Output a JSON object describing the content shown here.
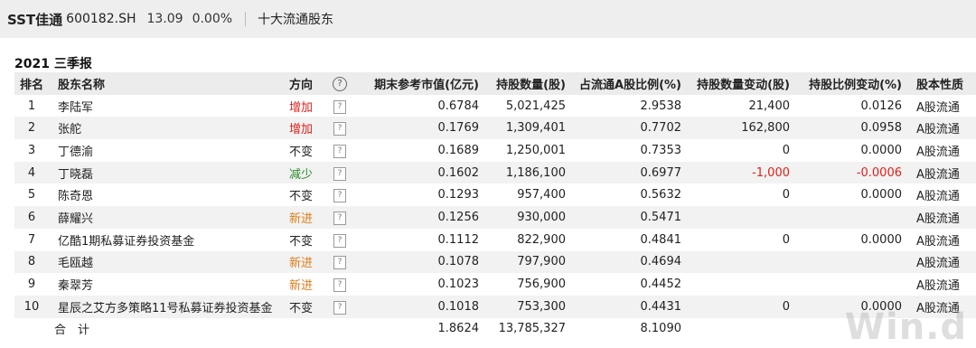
{
  "header": {
    "stock_name": "SST佳通",
    "stock_code": "600182.SH",
    "price": "13.09",
    "change_pct": "0.00%",
    "page_title": "十大流通股东"
  },
  "period": "2021 三季报",
  "columns": {
    "rank": "排名",
    "holder": "股东名称",
    "direction": "方向",
    "help": "?",
    "market_value": "期末参考市值(亿元)",
    "shares": "持股数量(股)",
    "ratio": "占流通A股比例(%)",
    "shares_change": "持股数量变动(股)",
    "ratio_change": "持股比例变动(%)",
    "share_type": "股本性质"
  },
  "rows": [
    {
      "rank": "1",
      "holder": "李陆军",
      "direction": "增加",
      "market_value": "0.6784",
      "shares": "5,021,425",
      "ratio": "2.9538",
      "shares_change": "21,400",
      "ratio_change": "0.0126",
      "share_type": "A股流通"
    },
    {
      "rank": "2",
      "holder": "张舵",
      "direction": "增加",
      "market_value": "0.1769",
      "shares": "1,309,401",
      "ratio": "0.7702",
      "shares_change": "162,800",
      "ratio_change": "0.0958",
      "share_type": "A股流通"
    },
    {
      "rank": "3",
      "holder": "丁德渝",
      "direction": "不变",
      "market_value": "0.1689",
      "shares": "1,250,001",
      "ratio": "0.7353",
      "shares_change": "0",
      "ratio_change": "0.0000",
      "share_type": "A股流通"
    },
    {
      "rank": "4",
      "holder": "丁晓磊",
      "direction": "减少",
      "market_value": "0.1602",
      "shares": "1,186,100",
      "ratio": "0.6977",
      "shares_change": "-1,000",
      "ratio_change": "-0.0006",
      "share_type": "A股流通"
    },
    {
      "rank": "5",
      "holder": "陈奇恩",
      "direction": "不变",
      "market_value": "0.1293",
      "shares": "957,400",
      "ratio": "0.5632",
      "shares_change": "0",
      "ratio_change": "0.0000",
      "share_type": "A股流通"
    },
    {
      "rank": "6",
      "holder": "薛耀兴",
      "direction": "新进",
      "market_value": "0.1256",
      "shares": "930,000",
      "ratio": "0.5471",
      "shares_change": "",
      "ratio_change": "",
      "share_type": "A股流通"
    },
    {
      "rank": "7",
      "holder": "亿酷1期私募证券投资基金",
      "direction": "不变",
      "market_value": "0.1112",
      "shares": "822,900",
      "ratio": "0.4841",
      "shares_change": "0",
      "ratio_change": "0.0000",
      "share_type": "A股流通"
    },
    {
      "rank": "8",
      "holder": "毛瓯越",
      "direction": "新进",
      "market_value": "0.1078",
      "shares": "797,900",
      "ratio": "0.4694",
      "shares_change": "",
      "ratio_change": "",
      "share_type": "A股流通"
    },
    {
      "rank": "9",
      "holder": "秦翠芳",
      "direction": "新进",
      "market_value": "0.1023",
      "shares": "756,900",
      "ratio": "0.4452",
      "shares_change": "",
      "ratio_change": "",
      "share_type": "A股流通"
    },
    {
      "rank": "10",
      "holder": "星辰之艾方多策略11号私募证券投资基金",
      "direction": "不变",
      "market_value": "0.1018",
      "shares": "753,300",
      "ratio": "0.4431",
      "shares_change": "0",
      "ratio_change": "0.0000",
      "share_type": "A股流通"
    }
  ],
  "total": {
    "label": "合　计",
    "market_value": "1.8624",
    "shares": "13,785,327",
    "ratio": "8.1090"
  },
  "watermark": "Win.d"
}
